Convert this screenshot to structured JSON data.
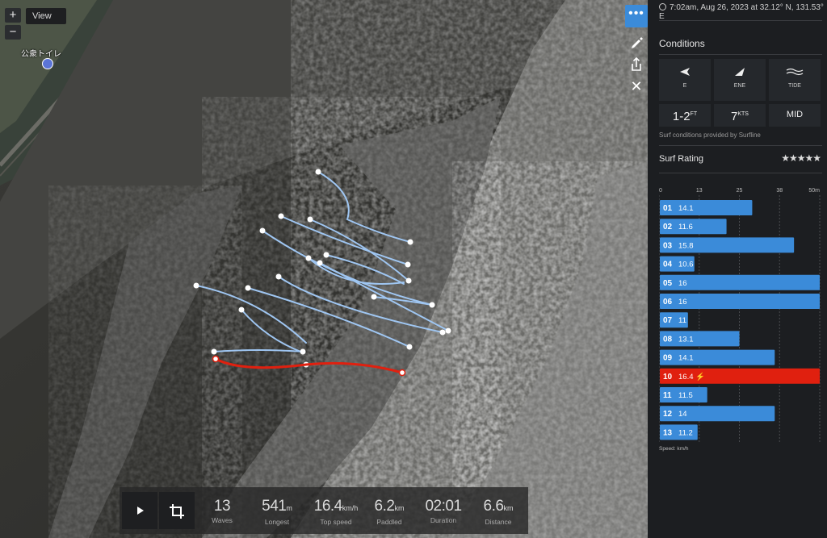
{
  "map": {
    "zoom_in": "+",
    "zoom_out": "−",
    "view_label": "View",
    "poi_label": "公衆トイレ",
    "tools": {
      "more": "•••",
      "close": "✕"
    }
  },
  "stats": [
    {
      "value": "13",
      "unit": "",
      "label": "Waves"
    },
    {
      "value": "541",
      "unit": "m",
      "label": "Longest"
    },
    {
      "value": "16.4",
      "unit": "km/h",
      "label": "Top speed"
    },
    {
      "value": "6.2",
      "unit": "km",
      "label": "Paddled"
    },
    {
      "value": "02:01",
      "unit": "",
      "label": "Duration"
    },
    {
      "value": "6.6",
      "unit": "km",
      "label": "Distance"
    }
  ],
  "sidebar": {
    "datetime": "7:02am, Aug 26, 2023 at 32.12° N, 131.53° E",
    "conditions_title": "Conditions",
    "cards": [
      {
        "icon": "swell-direction-icon",
        "label": "E",
        "value": "1-2",
        "unit": "FT"
      },
      {
        "icon": "wind-direction-icon",
        "label": "ENE",
        "value": "7",
        "unit": "KTS"
      },
      {
        "icon": "tide-icon",
        "label": "TIDE",
        "value": "MID",
        "unit": ""
      }
    ],
    "conditions_note": "Surf conditions provided by Surfline",
    "rating_title": "Surf Rating",
    "rating_stars": "★★★★★",
    "speed_unit": "Speed: km/h"
  },
  "chart_data": {
    "type": "bar",
    "orientation": "horizontal",
    "x_ticks": [
      "0",
      "13",
      "25",
      "38",
      "50m"
    ],
    "xlim": [
      0,
      50
    ],
    "categories": [
      "01",
      "02",
      "03",
      "04",
      "05",
      "06",
      "07",
      "08",
      "09",
      "10",
      "11",
      "12",
      "13"
    ],
    "values": [
      14.1,
      11.6,
      15.8,
      10.6,
      16,
      16,
      11,
      13.1,
      14.1,
      16.4,
      11.5,
      14,
      11.2
    ],
    "labels": [
      "14.1",
      "11.6",
      "15.8",
      "10.6",
      "16",
      "16",
      "11",
      "13.1",
      "14.1",
      "16.4",
      "11.5",
      "14",
      "11.2"
    ],
    "bar_lengths_m": [
      29,
      21,
      42,
      11,
      50,
      50,
      9,
      25,
      36,
      50,
      15,
      36,
      12
    ],
    "highlight_index": 9,
    "highlight_marker": "⚡",
    "colors": {
      "bar": "#3b8bd9",
      "highlight": "#e0200f",
      "grid": "#4a4c50"
    }
  }
}
